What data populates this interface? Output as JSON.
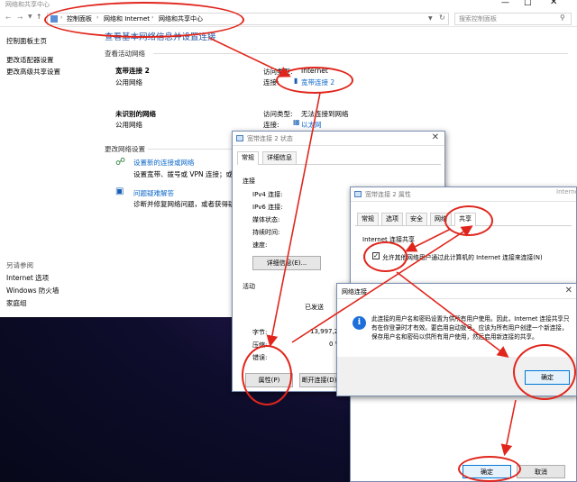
{
  "main_window": {
    "title": "网络和共享中心",
    "breadcrumb": [
      "控制面板",
      "网络和 Internet",
      "网络和共享中心"
    ],
    "search_placeholder": "搜索控制面板",
    "heading": "查看基本网络信息并设置连接",
    "active_section": "查看活动网络",
    "networks": [
      {
        "name": "宽带连接 2",
        "type": "公用网络",
        "access_label": "访问类型:",
        "access_value": "Internet",
        "conn_label": "连接:",
        "conn_value": "宽带连接 2"
      },
      {
        "name": "未识别的网络",
        "type": "公用网络",
        "access_label": "访问类型:",
        "access_value": "无法连接到网络",
        "conn_label": "连接:",
        "conn_value": "以太网"
      }
    ],
    "change_section": "更改网络设置",
    "tasks": [
      {
        "title": "设置新的连接或网络",
        "desc": "设置宽带、拨号或 VPN 连接；或设"
      },
      {
        "title": "问题疑难解答",
        "desc": "诊断并修复网络问题，或者获得疑"
      }
    ],
    "sidebar_links": [
      "控制面板主页",
      "更改适配器设置",
      "更改高级共享设置"
    ],
    "see_also": "另请参阅",
    "see_also_links": [
      "Internet 选项",
      "Windows 防火墙",
      "家庭组"
    ]
  },
  "status_window": {
    "title": "宽带连接 2 状态",
    "tabs": [
      "常规",
      "详细信息"
    ],
    "connection_section": "连接",
    "rows": [
      "IPv4 连接:",
      "IPv6 连接:",
      "媒体状态:",
      "持续时间:",
      "速度:"
    ],
    "details_button": "详细信息(E)...",
    "activity_section": "活动",
    "sent_label": "已发送",
    "bytes_label": "字节:",
    "bytes_value": "13,997,26",
    "compress_label": "压缩:",
    "compress_value": "0 %",
    "errors_label": "错误:",
    "properties_button": "属性(P)",
    "disconnect_button": "断开连接(D)"
  },
  "props_window": {
    "title": "宽带连接 2 属性",
    "tabs": [
      "常规",
      "选项",
      "安全",
      "网络",
      "共享"
    ],
    "ics_section": "Internet 连接共享",
    "allow_checkbox": "允许其他网络用户通过此计算机的 Internet 连接来连接(N)",
    "bg_text": "Internet"
  },
  "dialog": {
    "title": "网络连接",
    "message": "此连接的用户名和密码设置为供所有用户使用。因此，Internet 连接共享只有在你登录时才有效。要启用自动拨号，应该为所有用户创建一个新连接，保存用户名和密码以供所有用户使用，然后启用新连接的共享。",
    "ok_button": "确定"
  },
  "props_footer": {
    "ok_button": "确定",
    "cancel_button": "取消"
  },
  "colors": {
    "annotation": "#e0261c",
    "link": "#0b66c8"
  }
}
